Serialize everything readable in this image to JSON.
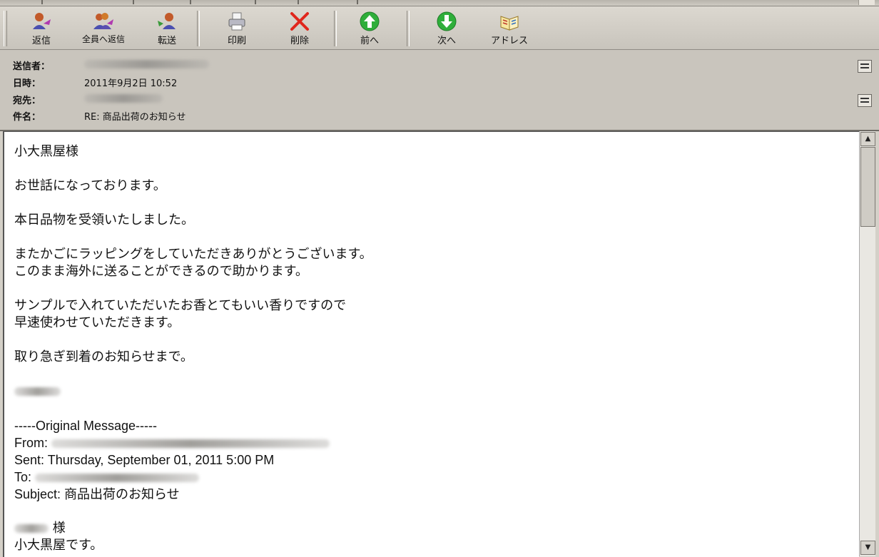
{
  "toolbar": {
    "buttons": [
      {
        "label": "返信",
        "icon": "reply-icon"
      },
      {
        "label": "全員へ返信",
        "icon": "reply-all-icon"
      },
      {
        "label": "転送",
        "icon": "forward-icon"
      },
      {
        "label": "印刷",
        "icon": "printer-icon"
      },
      {
        "label": "削除",
        "icon": "delete-icon"
      },
      {
        "label": "前へ",
        "icon": "up-arrow-icon"
      },
      {
        "label": "次へ",
        "icon": "down-arrow-icon"
      },
      {
        "label": "アドレス",
        "icon": "address-book-icon"
      }
    ]
  },
  "header": {
    "from_label": "送信者：",
    "date_label": "日時：",
    "date_value": "2011年9月2日 10:52",
    "to_label": "宛先：",
    "subject_label": "件名：",
    "subject_value": "RE: 商品出荷のお知らせ"
  },
  "message": {
    "lines": [
      "小大黒屋様",
      "お世話になっております。",
      "本日品物を受領いたしました。",
      "またかごにラッピングをしていただきありがとうございます。",
      "このまま海外に送ることができるので助かります。",
      "サンプルで入れていただいたお香とてもいい香りですので",
      "早速使わせていただきます。",
      "取り急ぎ到着のお知らせまで。"
    ],
    "original_header": "-----Original Message-----",
    "from_label": "From:",
    "sent_label": "Sent: Thursday, September 01, 2011 5:00 PM",
    "to_label": "To:",
    "subject_line": "Subject: 商品出荷のお知らせ",
    "salutation_suffix": "様",
    "intro_line": "小大黒屋です。"
  },
  "colors": {
    "toolbar_bg": "#d4d0c8",
    "header_bg": "#c9c5bd",
    "body_bg": "#ffffff"
  }
}
